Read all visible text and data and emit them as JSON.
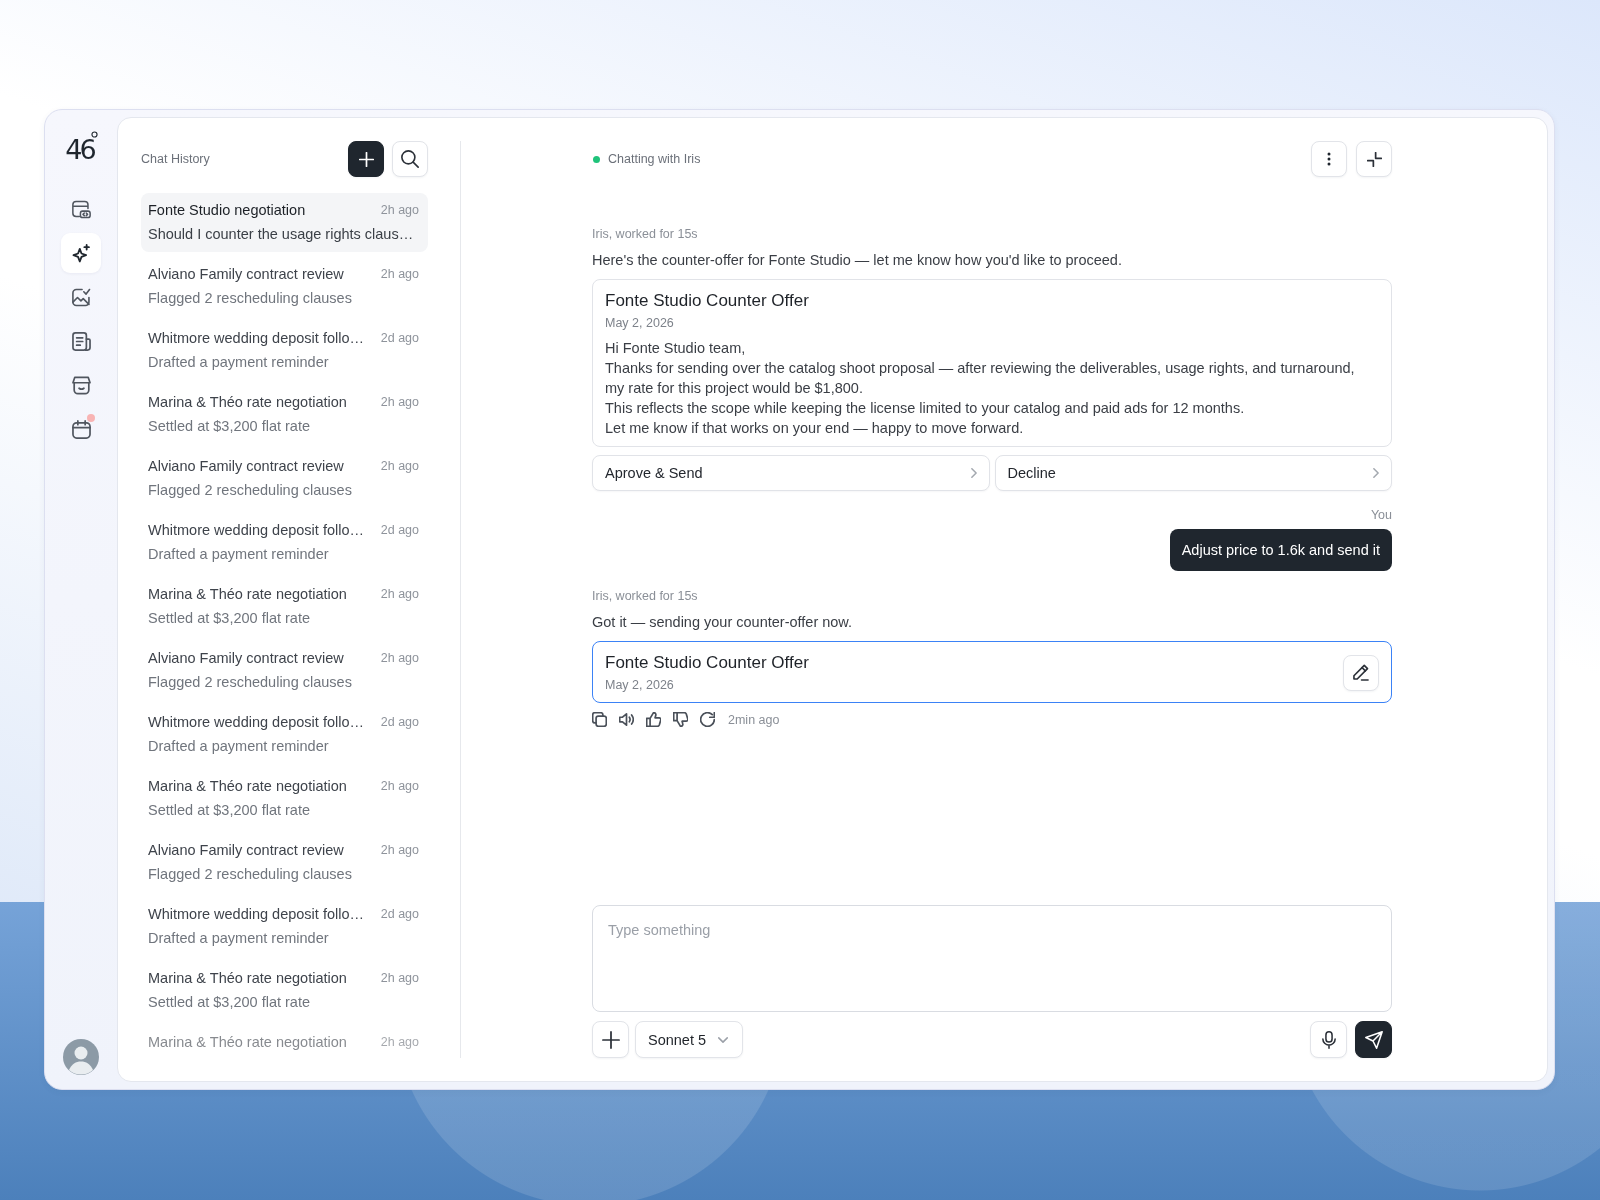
{
  "rail": {
    "logo": "46",
    "items": [
      {
        "kind": "code",
        "selected": false,
        "badge": false
      },
      {
        "kind": "sparkle",
        "selected": true,
        "badge": false
      },
      {
        "kind": "gallery",
        "selected": false,
        "badge": false
      },
      {
        "kind": "document",
        "selected": false,
        "badge": false
      },
      {
        "kind": "store",
        "selected": false,
        "badge": false
      },
      {
        "kind": "calendar",
        "selected": false,
        "badge": true
      }
    ]
  },
  "sidebar": {
    "title": "Chat History",
    "items": [
      {
        "title": "Fonte Studio negotiation",
        "time": "2h ago",
        "preview": "Should I counter the usage rights claus…",
        "selected": true
      },
      {
        "title": "Alviano Family contract review",
        "time": "2h ago",
        "preview": "Flagged 2 rescheduling clauses",
        "selected": false
      },
      {
        "title": "Whitmore wedding deposit follo…",
        "time": "2d ago",
        "preview": "Drafted a payment reminder",
        "selected": false
      },
      {
        "title": "Marina & Théo rate negotiation",
        "time": "2h ago",
        "preview": "Settled at $3,200 flat rate",
        "selected": false
      },
      {
        "title": "Alviano Family contract review",
        "time": "2h ago",
        "preview": "Flagged 2 rescheduling clauses",
        "selected": false
      },
      {
        "title": "Whitmore wedding deposit follo…",
        "time": "2d ago",
        "preview": "Drafted a payment reminder",
        "selected": false
      },
      {
        "title": "Marina & Théo rate negotiation",
        "time": "2h ago",
        "preview": "Settled at $3,200 flat rate",
        "selected": false
      },
      {
        "title": "Alviano Family contract review",
        "time": "2h ago",
        "preview": "Flagged 2 rescheduling clauses",
        "selected": false
      },
      {
        "title": "Whitmore wedding deposit follo…",
        "time": "2d ago",
        "preview": "Drafted a payment reminder",
        "selected": false
      },
      {
        "title": "Marina & Théo rate negotiation",
        "time": "2h ago",
        "preview": "Settled at $3,200 flat rate",
        "selected": false
      },
      {
        "title": "Alviano Family contract review",
        "time": "2h ago",
        "preview": "Flagged 2 rescheduling clauses",
        "selected": false
      },
      {
        "title": "Whitmore wedding deposit follo…",
        "time": "2d ago",
        "preview": "Drafted a payment reminder",
        "selected": false
      },
      {
        "title": "Marina & Théo rate negotiation",
        "time": "2h ago",
        "preview": "Settled at $3,200 flat rate",
        "selected": false
      },
      {
        "title": "Marina & Théo rate negotiation",
        "time": "2h ago",
        "selected": false
      }
    ]
  },
  "chat": {
    "header": {
      "status": "Chatting with Iris",
      "online": true
    },
    "messages": [
      {
        "kind": "assistant",
        "meta": "Iris, worked for 15s",
        "text": "Here's the counter-offer for Fonte Studio — let me know how you'd like to proceed.",
        "card": {
          "title": "Fonte Studio Counter Offer",
          "date": "May 2, 2026",
          "body": [
            "Hi Fonte Studio team,",
            "Thanks for sending over the catalog shoot proposal — after reviewing the deliverables, usage rights, and turnaround, my rate for this project would be $1,800.",
            "This reflects the scope while keeping the license limited to your catalog and paid ads for 12 months.",
            "Let me know if that works on your end — happy to move forward."
          ],
          "selected": false,
          "editable": false
        },
        "actions": [
          "Aprove & Send",
          "Decline"
        ]
      },
      {
        "kind": "user",
        "sender": "You",
        "text": "Adjust price to 1.6k and send it"
      },
      {
        "kind": "assistant",
        "meta": "Iris, worked for 15s",
        "text": "Got it — sending your counter-offer now.",
        "card": {
          "title": "Fonte Studio Counter Offer",
          "date": "May 2, 2026",
          "selected": true,
          "editable": true
        },
        "footer": {
          "time": "2min ago"
        }
      }
    ],
    "composer": {
      "placeholder": "Type something",
      "model": "Sonnet 5"
    }
  }
}
